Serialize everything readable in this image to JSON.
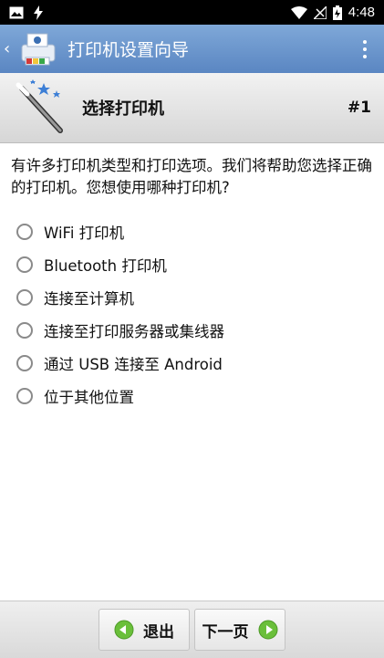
{
  "status_bar": {
    "time": "4:48",
    "icons": [
      "image-icon",
      "flash-icon",
      "wifi-icon",
      "no-sim-icon",
      "battery-icon"
    ]
  },
  "app_bar": {
    "title": "打印机设置向导",
    "icons": [
      "back-icon",
      "printer-logo-icon",
      "overflow-menu-icon"
    ]
  },
  "step": {
    "title": "选择打印机",
    "number": "#1",
    "icon": "magic-wand-icon"
  },
  "question": "有许多打印机类型和打印选项。我们将帮助您选择正确的打印机。您想使用哪种打印机?",
  "options": [
    {
      "label": "WiFi 打印机",
      "selected": false
    },
    {
      "label": "Bluetooth 打印机",
      "selected": false
    },
    {
      "label": "连接至计算机",
      "selected": false
    },
    {
      "label": "连接至打印服务器或集线器",
      "selected": false
    },
    {
      "label": "通过 USB 连接至 Android",
      "selected": false
    },
    {
      "label": "位于其他位置",
      "selected": false
    }
  ],
  "buttons": {
    "exit_label": "退出",
    "next_label": "下一页"
  },
  "colors": {
    "app_bar": "#6b95cc",
    "accent_green": "#6abf3a"
  }
}
